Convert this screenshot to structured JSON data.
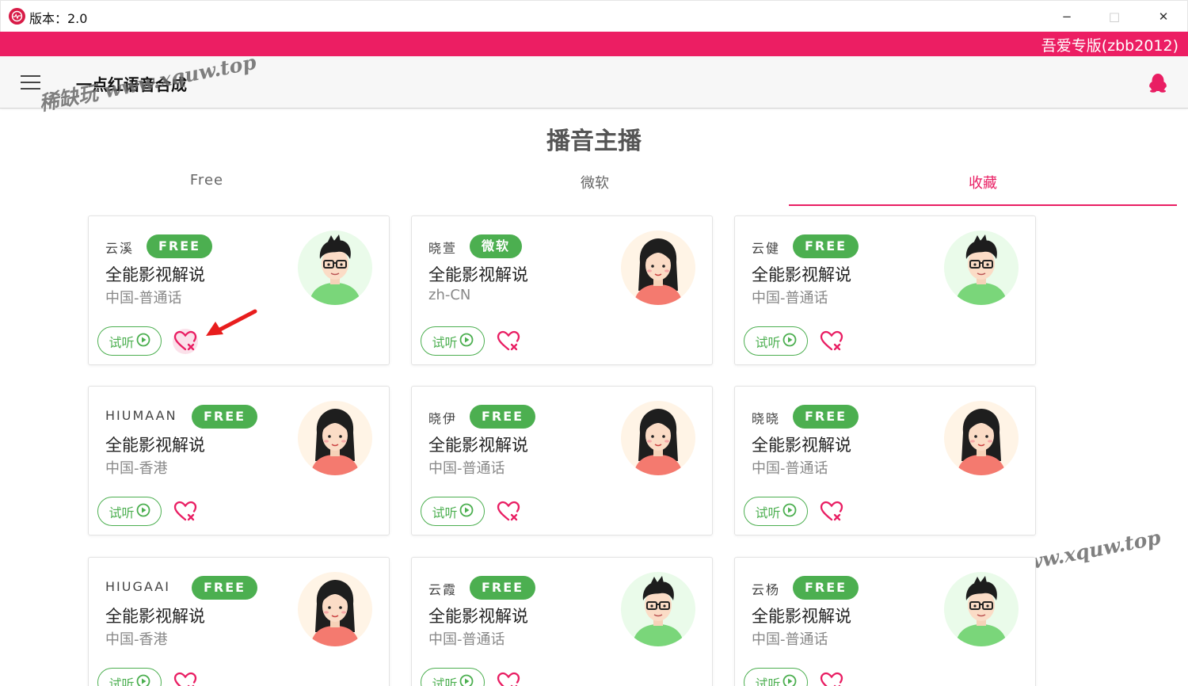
{
  "window": {
    "title": "版本：2.0",
    "minimize": "−",
    "maximize": "□",
    "close": "✕"
  },
  "banner": {
    "text": "吾爱专版(zbb2012)"
  },
  "appbar": {
    "title": "一点红语音合成"
  },
  "watermark": "稀缺玩 www.xquw.top",
  "page": {
    "title": "播音主播"
  },
  "tabs": [
    {
      "label": "Free",
      "active": false
    },
    {
      "label": "微软",
      "active": false
    },
    {
      "label": "收藏",
      "active": true
    }
  ],
  "colors": {
    "accent": "#e91e63",
    "banner": "#ec1e63",
    "badge": "#4caf50"
  },
  "cards": [
    {
      "name": "云溪",
      "badge": "FREE",
      "style": "全能影视解说",
      "lang": "中国-普通话",
      "avatar": "male",
      "listen": "试听"
    },
    {
      "name": "晓萱",
      "badge": "微软",
      "style": "全能影视解说",
      "lang": "zh-CN",
      "avatar": "female",
      "listen": "试听"
    },
    {
      "name": "云健",
      "badge": "FREE",
      "style": "全能影视解说",
      "lang": "中国-普通话",
      "avatar": "male",
      "listen": "试听"
    },
    {
      "name": "HIUMAAN",
      "badge": "FREE",
      "style": "全能影视解说",
      "lang": "中国-香港",
      "avatar": "female",
      "listen": "试听"
    },
    {
      "name": "晓伊",
      "badge": "FREE",
      "style": "全能影视解说",
      "lang": "中国-普通话",
      "avatar": "female",
      "listen": "试听"
    },
    {
      "name": "晓晓",
      "badge": "FREE",
      "style": "全能影视解说",
      "lang": "中国-普通话",
      "avatar": "female",
      "listen": "试听"
    },
    {
      "name": "HIUGAAI",
      "badge": "FREE",
      "style": "全能影视解说",
      "lang": "中国-香港",
      "avatar": "female",
      "listen": "试听"
    },
    {
      "name": "云霞",
      "badge": "FREE",
      "style": "全能影视解说",
      "lang": "中国-普通话",
      "avatar": "male",
      "listen": "试听"
    },
    {
      "name": "云杨",
      "badge": "FREE",
      "style": "全能影视解说",
      "lang": "中国-普通话",
      "avatar": "male",
      "listen": "试听"
    }
  ]
}
